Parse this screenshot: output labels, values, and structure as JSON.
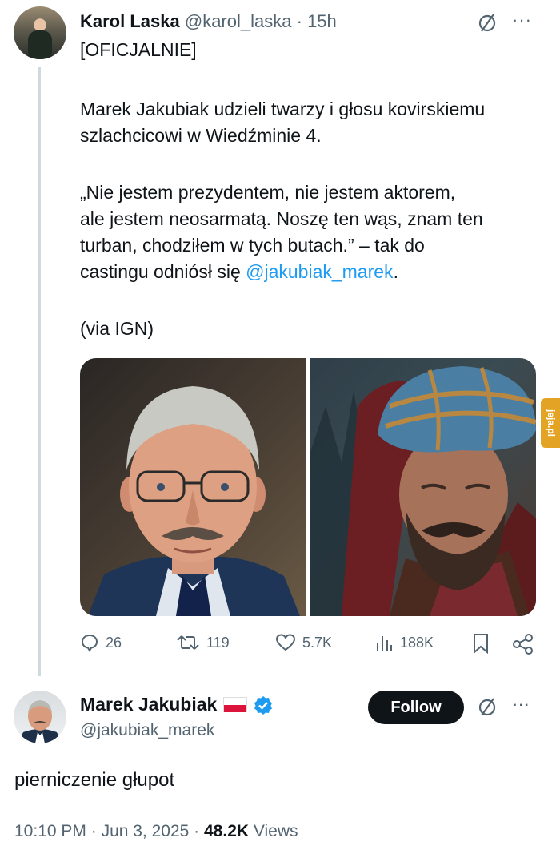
{
  "tweet1": {
    "author_name": "Karol Laska",
    "handle": "@karol_laska",
    "separator": "·",
    "time": "15h",
    "more_label": "···",
    "label_line": "[OFICJALNIE]",
    "paragraph1_line1": "Marek Jakubiak udzieli twarzy i głosu kovirskiemu",
    "paragraph1_line2": "szlachcicowi w Wiedźminie 4.",
    "quote_line1": "„Nie jestem prezydentem, nie jestem aktorem,",
    "quote_line2": "ale jestem neosarmatą. Noszę ten wąs, znam ten",
    "quote_line3": "turban, chodziłem w tych butach.” – tak do",
    "quote_line4_prefix": "castingu odniósł się ",
    "quote_mention": "@jakubiak_marek",
    "quote_line4_suffix": ".",
    "source": "(via IGN)",
    "actions": {
      "replies": "26",
      "reposts": "119",
      "likes": "5.7K",
      "views": "188K"
    }
  },
  "watermark": "jeja.pl",
  "tweet2": {
    "author_name": "Marek Jakubiak",
    "handle": "@jakubiak_marek",
    "follow_label": "Follow",
    "more_label": "···",
    "text": "pierniczenie głupot",
    "time": "10:10 PM",
    "separator1": " · ",
    "date": "Jun 3, 2025",
    "separator2": " · ",
    "views_count": "48.2K",
    "views_label": " Views"
  },
  "colors": {
    "accent": "#1d9bf0",
    "secondary_text": "#536471",
    "primary_text": "#0f1419",
    "verified": "#1d9bf0",
    "watermark": "#e3a324"
  }
}
